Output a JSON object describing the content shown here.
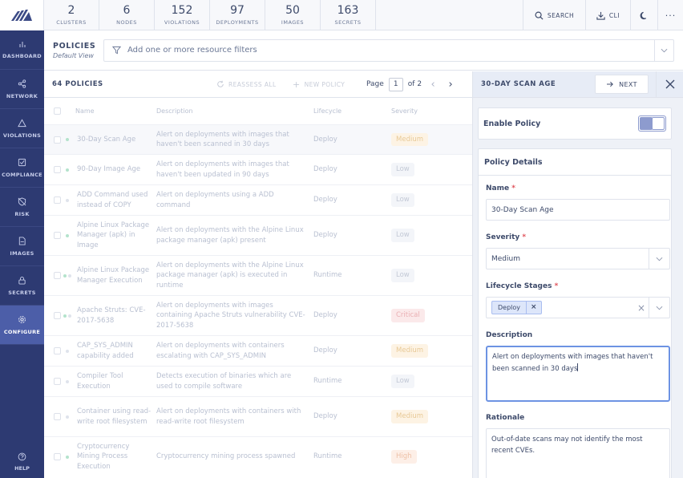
{
  "summary": [
    {
      "count": "2",
      "label": "CLUSTERS"
    },
    {
      "count": "6",
      "label": "NODES"
    },
    {
      "count": "152",
      "label": "VIOLATIONS"
    },
    {
      "count": "97",
      "label": "DEPLOYMENTS"
    },
    {
      "count": "50",
      "label": "IMAGES"
    },
    {
      "count": "163",
      "label": "SECRETS"
    }
  ],
  "top_actions": {
    "search": "SEARCH",
    "cli": "CLI"
  },
  "nav": [
    {
      "label": "DASHBOARD",
      "icon": "bar-chart-icon"
    },
    {
      "label": "NETWORK",
      "icon": "share-icon"
    },
    {
      "label": "VIOLATIONS",
      "icon": "alert-triangle-icon"
    },
    {
      "label": "COMPLIANCE",
      "icon": "check-square-icon"
    },
    {
      "label": "RISK",
      "icon": "shield-off-icon"
    },
    {
      "label": "IMAGES",
      "icon": "file-icon"
    },
    {
      "label": "SECRETS",
      "icon": "lock-icon"
    },
    {
      "label": "CONFIGURE",
      "icon": "gear-icon",
      "active": true
    }
  ],
  "help_label": "HELP",
  "page": {
    "title": "POLICIES",
    "view": "Default View"
  },
  "filter": {
    "placeholder": "Add one or more resource filters"
  },
  "table": {
    "count_label": "64 POLICIES",
    "reassess_label": "REASSESS ALL",
    "new_policy_label": "NEW POLICY",
    "page_label": "Page",
    "page_current": "1",
    "page_total": "of 2",
    "columns": {
      "name": "Name",
      "description": "Description",
      "lifecycle": "Lifecycle",
      "severity": "Severity"
    },
    "rows": [
      {
        "name": "30-Day Scan Age",
        "description": "Alert on deployments with images that haven't been scanned in 30 days",
        "lifecycle": "Deploy",
        "severity": "Medium",
        "enabled": true,
        "selected": true,
        "sev_class": "sev-medium"
      },
      {
        "name": "90-Day Image Age",
        "description": "Alert on deployments with images that haven't been updated in 90 days",
        "lifecycle": "Deploy",
        "severity": "Low",
        "enabled": true,
        "sev_class": "sev-low"
      },
      {
        "name": "ADD Command used instead of COPY",
        "description": "Alert on deployments using a ADD command",
        "lifecycle": "Deploy",
        "severity": "Low",
        "enabled": false,
        "sev_class": "sev-low"
      },
      {
        "name": "Alpine Linux Package Manager (apk) in Image",
        "description": "Alert on deployments with the Alpine Linux package manager (apk) present",
        "lifecycle": "Deploy",
        "severity": "Low",
        "enabled": true,
        "sev_class": "sev-low"
      },
      {
        "name": "Alpine Linux Package Manager Execution",
        "description": "Alert on deployments with the Alpine Linux package manager (apk) is executed in runtime",
        "lifecycle": "Runtime",
        "severity": "Low",
        "enabled": true,
        "sev_class": "sev-low"
      },
      {
        "name": "Apache Struts: CVE-2017-5638",
        "description": "Alert on deployments with images containing Apache Struts vulnerability CVE-2017-5638",
        "lifecycle": "Deploy",
        "severity": "Critical",
        "enabled": true,
        "sev_class": "sev-critical"
      },
      {
        "name": "CAP_SYS_ADMIN capability added",
        "description": "Alert on deployments with containers escalating with CAP_SYS_ADMIN",
        "lifecycle": "Deploy",
        "severity": "Medium",
        "enabled": false,
        "sev_class": "sev-medium"
      },
      {
        "name": "Compiler Tool Execution",
        "description": "Detects execution of binaries which are used to compile software",
        "lifecycle": "Runtime",
        "severity": "Low",
        "enabled": false,
        "sev_class": "sev-low"
      },
      {
        "name": "Container using read-write root filesystem",
        "description": "Alert on deployments with containers with read-write root filesystem",
        "lifecycle": "Deploy",
        "severity": "Medium",
        "enabled": false,
        "sev_class": "sev-medium"
      },
      {
        "name": "Cryptocurrency Mining Process Execution",
        "description": "Cryptocurrency mining process spawned",
        "lifecycle": "Runtime",
        "severity": "High",
        "enabled": true,
        "sev_class": "sev-high"
      }
    ]
  },
  "panel": {
    "title": "30-DAY SCAN AGE",
    "next_label": "NEXT",
    "enable_label": "Enable Policy",
    "details_label": "Policy Details",
    "name_label": "Name",
    "name_value": "30-Day Scan Age",
    "severity_label": "Severity",
    "severity_value": "Medium",
    "lifecycle_label": "Lifecycle Stages",
    "lifecycle_chip": "Deploy",
    "description_label": "Description",
    "description_value": "Alert on deployments with images that haven't been scanned in 30 days",
    "rationale_label": "Rationale",
    "rationale_value": "Out-of-date scans may not identify the most recent CVEs."
  },
  "colors": {
    "nav_bg": "#2d3a72",
    "nav_active": "#4c5ea8",
    "accent": "#6d93e3",
    "required": "#e0525a"
  }
}
